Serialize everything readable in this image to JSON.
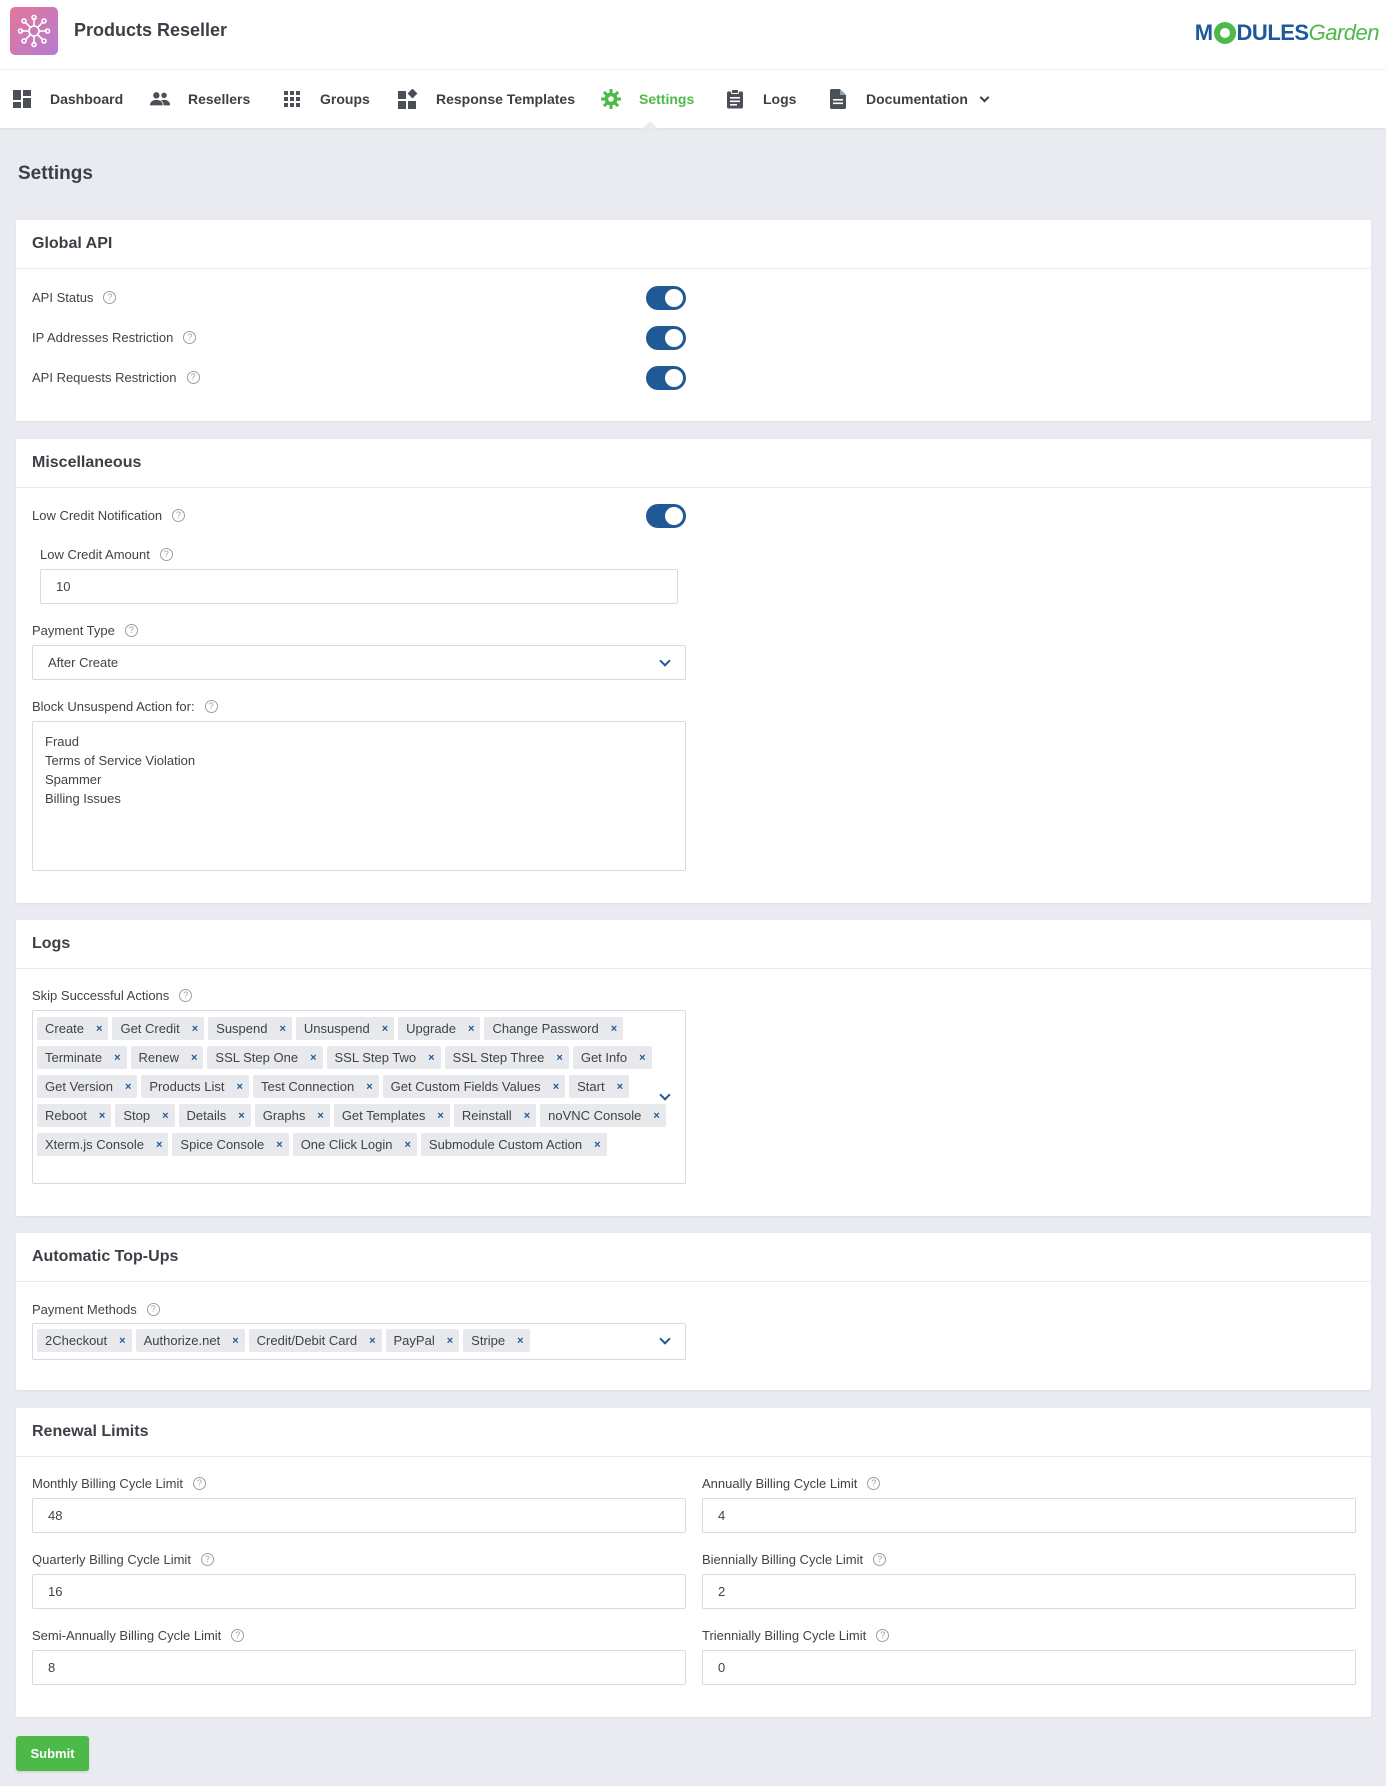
{
  "header": {
    "app_title": "Products Reseller",
    "brand_part1": "M",
    "brand_part2": "DULES",
    "brand_part3": "Garden"
  },
  "nav": {
    "dashboard": "Dashboard",
    "resellers": "Resellers",
    "groups": "Groups",
    "response_templates": "Response Templates",
    "settings": "Settings",
    "logs": "Logs",
    "documentation": "Documentation"
  },
  "page_title": "Settings",
  "global_api": {
    "title": "Global API",
    "api_status": "API Status",
    "ip_restriction": "IP Addresses Restriction",
    "requests_restriction": "API Requests Restriction"
  },
  "misc": {
    "title": "Miscellaneous",
    "low_credit_notification": "Low Credit Notification",
    "low_credit_amount_label": "Low Credit Amount",
    "low_credit_amount_value": "10",
    "payment_type_label": "Payment Type",
    "payment_type_value": "After Create",
    "block_unsuspend_label": "Block Unsuspend Action for:",
    "block_unsuspend_options": [
      "Fraud",
      "Terms of Service Violation",
      "Spammer",
      "Billing Issues"
    ]
  },
  "logs": {
    "title": "Logs",
    "skip_label": "Skip Successful Actions",
    "tags": [
      "Create",
      "Get Credit",
      "Suspend",
      "Unsuspend",
      "Upgrade",
      "Change Password",
      "Terminate",
      "Renew",
      "SSL Step One",
      "SSL Step Two",
      "SSL Step Three",
      "Get Info",
      "Get Version",
      "Products List",
      "Test Connection",
      "Get Custom Fields Values",
      "Start",
      "Reboot",
      "Stop",
      "Details",
      "Graphs",
      "Get Templates",
      "Reinstall",
      "noVNC Console",
      "Xterm.js Console",
      "Spice Console",
      "One Click Login",
      "Submodule Custom Action"
    ]
  },
  "topups": {
    "title": "Automatic Top-Ups",
    "payment_methods_label": "Payment Methods",
    "tags": [
      "2Checkout",
      "Authorize.net",
      "Credit/Debit Card",
      "PayPal",
      "Stripe"
    ]
  },
  "renewal": {
    "title": "Renewal Limits",
    "monthly_label": "Monthly Billing Cycle Limit",
    "monthly_value": "48",
    "quarterly_label": "Quarterly Billing Cycle Limit",
    "quarterly_value": "16",
    "semiannually_label": "Semi-Annually Billing Cycle Limit",
    "semiannually_value": "8",
    "annually_label": "Annually Billing Cycle Limit",
    "annually_value": "4",
    "biennially_label": "Biennially Billing Cycle Limit",
    "biennially_value": "2",
    "triennially_label": "Triennially Billing Cycle Limit",
    "triennially_value": "0"
  },
  "submit_label": "Submit",
  "colors": {
    "accent_green": "#4cb948",
    "accent_blue": "#1f5a96"
  }
}
